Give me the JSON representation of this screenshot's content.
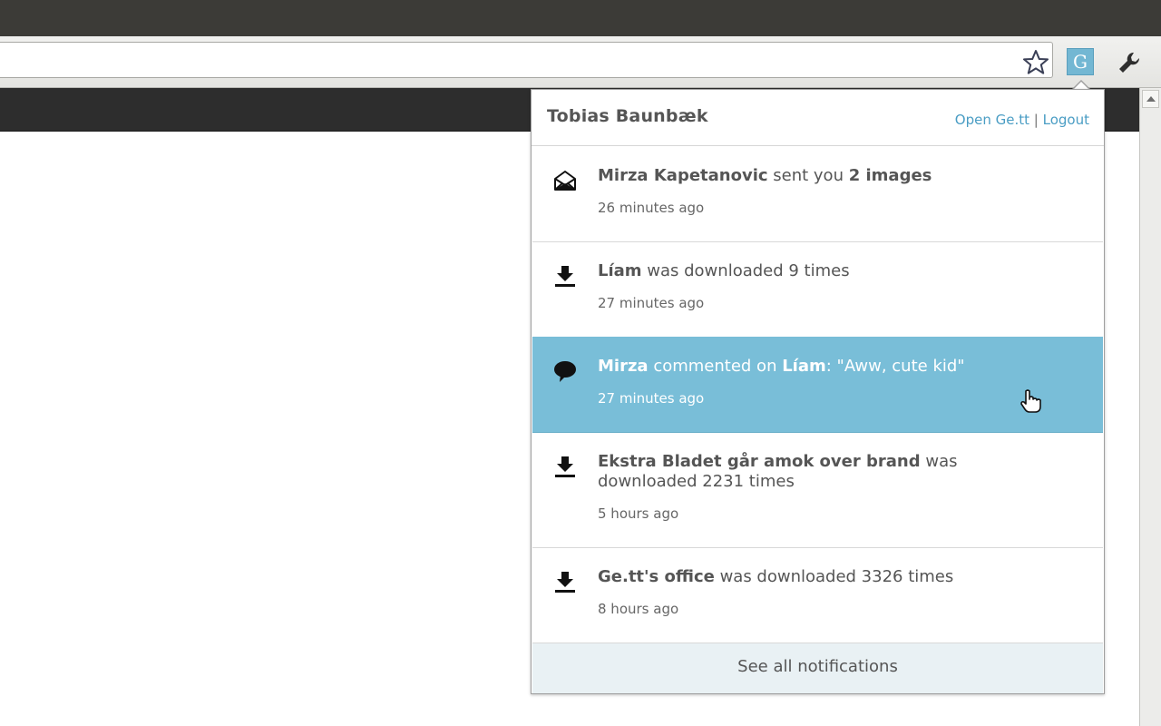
{
  "toolbar": {
    "star_icon": "star-outline-icon",
    "extension_badge": "G",
    "wrench_icon": "wrench-icon"
  },
  "popup": {
    "user_name": "Tobias Baunbæk",
    "open_link": "Open Ge.tt",
    "separator": "|",
    "logout_link": "Logout",
    "footer_link": "See all notifications",
    "notifications": [
      {
        "icon": "envelope-open-icon",
        "actor": "Mirza Kapetanovic",
        "verb": " sent you ",
        "object": "2 images",
        "tail": "",
        "time": "26 minutes ago"
      },
      {
        "icon": "download-icon",
        "actor": "Líam",
        "verb": " was downloaded 9 times",
        "object": "",
        "tail": "",
        "time": "27 minutes ago"
      },
      {
        "icon": "comment-icon",
        "actor": "Mirza",
        "verb": " commented on ",
        "object": "Líam",
        "tail": ": \"Aww, cute kid\"",
        "time": "27 minutes ago",
        "highlighted": true
      },
      {
        "icon": "download-icon",
        "actor": "Ekstra Bladet går amok over brand",
        "verb": " was downloaded 2231 times",
        "object": "",
        "tail": "",
        "time": "5 hours ago"
      },
      {
        "icon": "download-icon",
        "actor": "Ge.tt's office",
        "verb": " was downloaded 3326 times",
        "object": "",
        "tail": "",
        "time": "8 hours ago"
      }
    ]
  },
  "colors": {
    "accent": "#4a9dc4",
    "highlight": "#79bed8",
    "footer_bg": "#e9f1f4",
    "titlebar": "#3c3b37"
  }
}
